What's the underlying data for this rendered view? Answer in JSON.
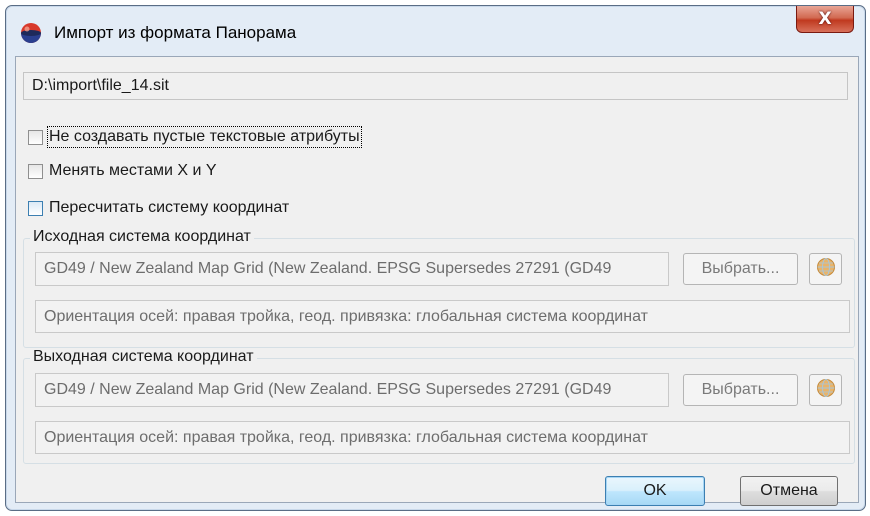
{
  "window": {
    "title": "Импорт из формата Панорама",
    "close_label": "X",
    "title_icon": "panorama-app-icon",
    "accent": "#c0391f"
  },
  "path": {
    "value": "D:\\import\\file_14.sit"
  },
  "options": [
    {
      "label": "Не создавать пустые текстовые атрибуты",
      "checked": false
    },
    {
      "label": "Менять местами X и Y",
      "checked": false
    },
    {
      "label": "Пересчитать систему координат",
      "checked": false
    }
  ],
  "source_cs": {
    "title": "Исходная система координат",
    "value": "GD49 / New Zealand Map Grid (New Zealand. EPSG Supersedes 27291 (GD49",
    "pick_label": "Выбрать...",
    "orientation": "Ориентация осей: правая тройка, геод. привязка: глобальная система координат",
    "icon": "globe-icon"
  },
  "target_cs": {
    "title": "Выходная система координат",
    "value": "GD49 / New Zealand Map Grid (New Zealand. EPSG Supersedes 27291 (GD49",
    "pick_label": "Выбрать...",
    "orientation": "Ориентация осей: правая тройка, геод. привязка: глобальная система координат",
    "icon": "globe-icon"
  },
  "buttons": {
    "ok": "OK",
    "cancel": "Отмена"
  }
}
